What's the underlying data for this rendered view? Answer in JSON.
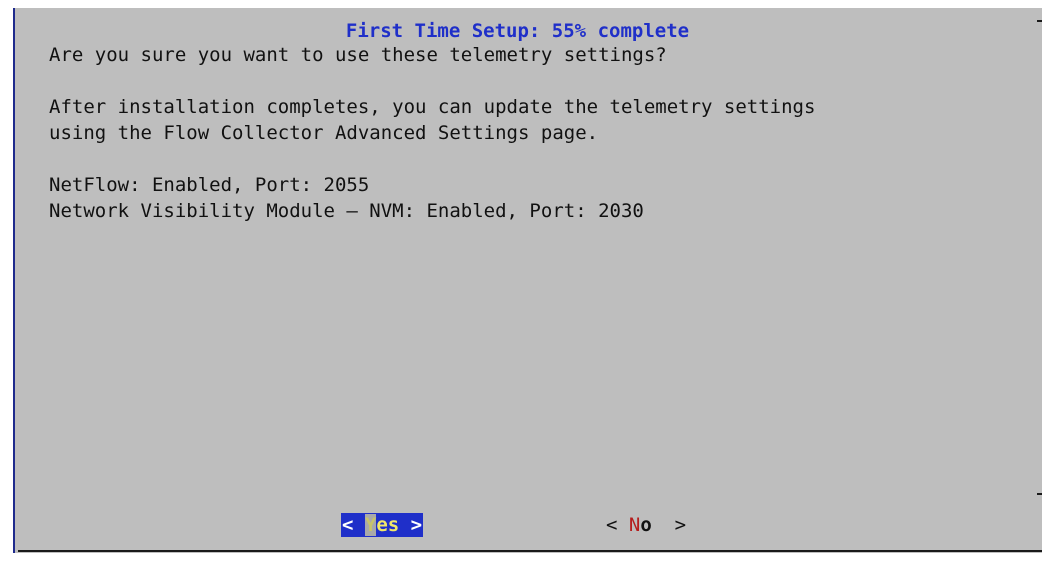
{
  "dialog": {
    "title": "First Time Setup: 55% complete",
    "progress_percent": 55,
    "lines": [
      "Are you sure you want to use these telemetry settings?",
      "After installation completes, you can update the telemetry settings",
      "using the Flow Collector Advanced Settings page.",
      "NetFlow: Enabled, Port: 2055",
      "Network Visibility Module – NVM: Enabled, Port: 2030"
    ]
  },
  "buttons": {
    "yes": {
      "open": "< ",
      "hotkey": "Y",
      "rest": "es",
      "close": " >"
    },
    "no": {
      "open": "< ",
      "hotkey": "N",
      "rest": "o",
      "close": "  >"
    }
  },
  "colors": {
    "dialog_background": "#bebebe",
    "title": "#1f2fc9",
    "selected_button_background": "#1f2fc9",
    "selected_button_text": "#f1e76a",
    "hotkey_no": "#b51c1c",
    "border_left": "#1e2a8c"
  }
}
